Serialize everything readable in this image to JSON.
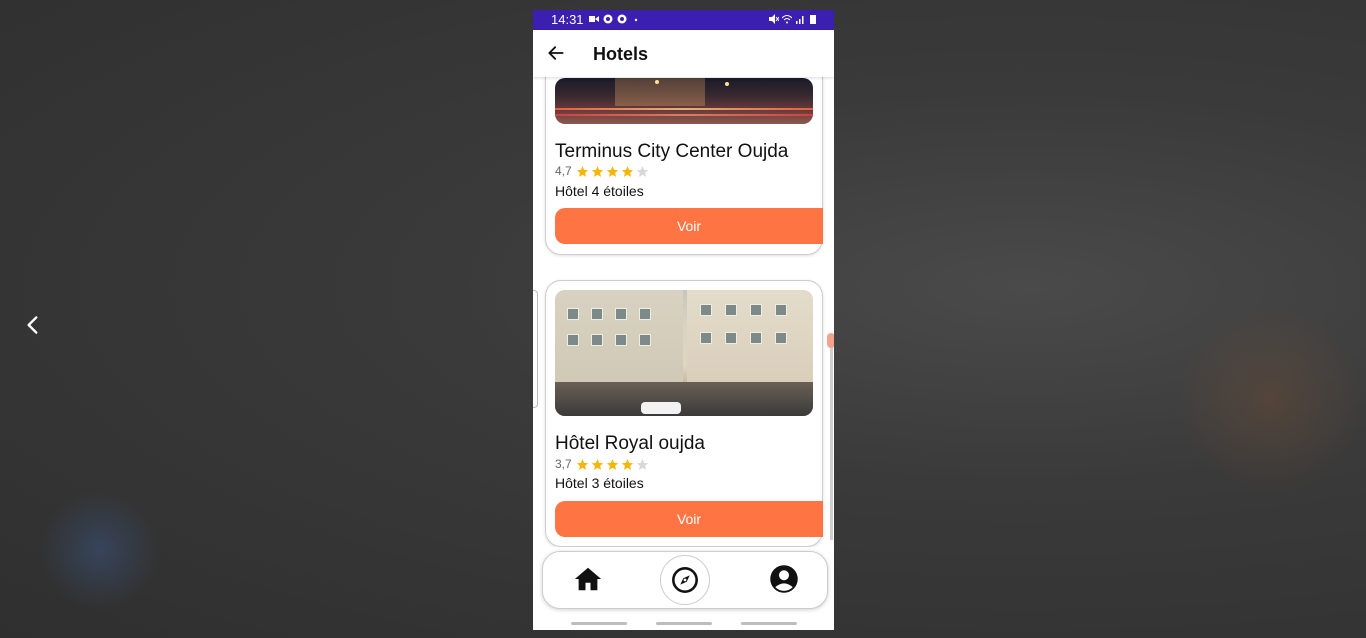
{
  "statusbar": {
    "time": "14:31"
  },
  "appbar": {
    "title": "Hotels"
  },
  "hotels": [
    {
      "name": "Terminus City Center Oujda",
      "rating": "4,7",
      "stars_filled": 4,
      "category": "Hôtel 4 étoiles",
      "button_label": "Voir"
    },
    {
      "name": "Hôtel Royal oujda",
      "rating": "3,7",
      "stars_filled": 4,
      "category": "Hôtel 3 étoiles",
      "button_label": "Voir"
    }
  ],
  "colors": {
    "statusbar": "#3a1fb0",
    "accent": "#ff7443",
    "star": "#f5b60a",
    "star_empty": "#d8d8d8"
  },
  "bottom_nav": [
    {
      "icon": "home-icon"
    },
    {
      "icon": "compass-icon"
    },
    {
      "icon": "profile-icon"
    }
  ]
}
